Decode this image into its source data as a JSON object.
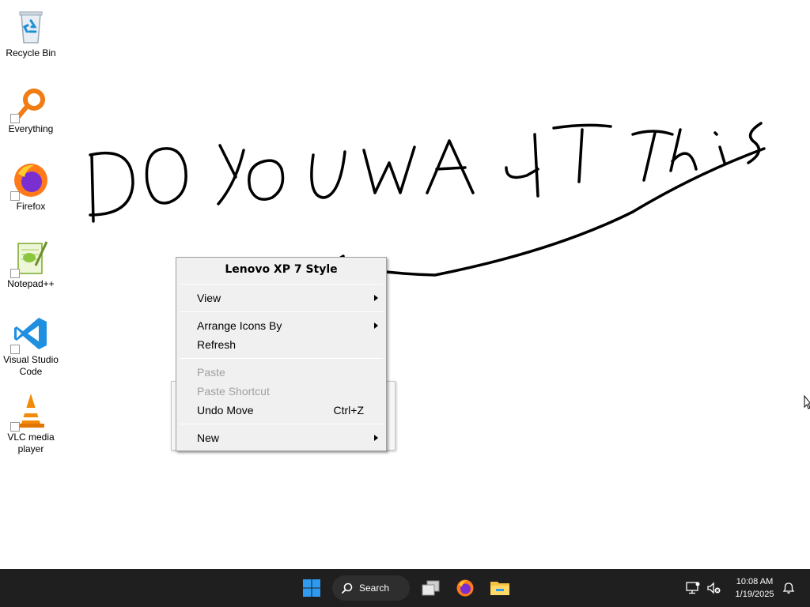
{
  "desktop": {
    "icons": [
      {
        "label": "Recycle Bin"
      },
      {
        "label": "Everything"
      },
      {
        "label": "Firefox"
      },
      {
        "label": "Notepad++"
      },
      {
        "label": "Visual Studio Code"
      },
      {
        "label": "VLC media player"
      }
    ],
    "handwriting": "DOYOUWANTThis"
  },
  "context_menu": {
    "header": "Lenovo XP 7 Style",
    "items": [
      {
        "label": "View",
        "submenu": true,
        "enabled": true
      },
      {
        "label": "Arrange Icons By",
        "submenu": true,
        "enabled": true
      },
      {
        "label": "Refresh",
        "submenu": false,
        "enabled": true
      },
      {
        "label": "Paste",
        "submenu": false,
        "enabled": false
      },
      {
        "label": "Paste Shortcut",
        "submenu": false,
        "enabled": false
      },
      {
        "label": "Undo Move",
        "shortcut": "Ctrl+Z",
        "submenu": false,
        "enabled": true
      },
      {
        "label": "New",
        "submenu": true,
        "enabled": true
      }
    ]
  },
  "taskbar": {
    "search_label": "Search",
    "clock_time": "10:08 AM",
    "clock_date": "1/19/2025",
    "background_color": "#1f1f1f",
    "icons": [
      "windows-start-icon",
      "search-icon",
      "task-view-icon",
      "firefox-icon",
      "file-explorer-icon",
      "network-icon",
      "volume-muted-icon",
      "notification-bell-icon"
    ]
  }
}
